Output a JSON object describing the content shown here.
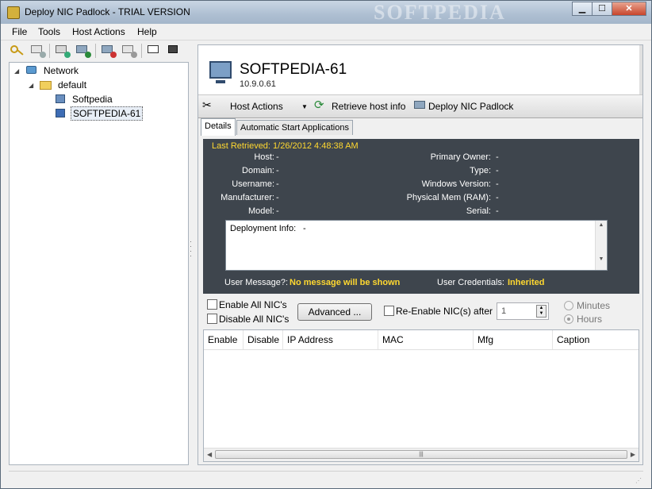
{
  "window": {
    "title": "Deploy NIC Padlock - TRIAL VERSION",
    "watermark": "SOFTPEDIA",
    "controls": {
      "minimize": "▁",
      "maximize": "☐",
      "close": "✕"
    }
  },
  "menu": [
    "File",
    "Tools",
    "Host Actions",
    "Help"
  ],
  "toolbar": {
    "icons": [
      "key-icon",
      "add-host-icon",
      "add-folder-icon",
      "add-network-icon",
      "remove-icon",
      "edit-icon",
      "console-icon",
      "binoculars-icon"
    ]
  },
  "tree": {
    "network": "Network",
    "group": "default",
    "hosts": [
      "Softpedia",
      "SOFTPEDIA-61"
    ],
    "selected": "SOFTPEDIA-61"
  },
  "host": {
    "name": "SOFTPEDIA-61",
    "ip": "10.9.0.61"
  },
  "actionbar": {
    "host_actions": "Host Actions",
    "retrieve": "Retrieve host info",
    "deploy": "Deploy NIC Padlock"
  },
  "tabs": [
    "Details",
    "Automatic Start Applications"
  ],
  "details": {
    "last_retrieved_label": "Last Retrieved:",
    "last_retrieved_value": "1/26/2012 4:48:38 AM",
    "left": [
      {
        "label": "Host:",
        "value": "-"
      },
      {
        "label": "Domain:",
        "value": "-"
      },
      {
        "label": "Username:",
        "value": "-"
      },
      {
        "label": "Manufacturer:",
        "value": "-"
      },
      {
        "label": "Model:",
        "value": "-"
      }
    ],
    "right": [
      {
        "label": "Primary Owner:",
        "value": "-"
      },
      {
        "label": "Type:",
        "value": "-"
      },
      {
        "label": "Windows Version:",
        "value": "-"
      },
      {
        "label": "Physical Mem (RAM):",
        "value": "-"
      },
      {
        "label": "Serial:",
        "value": "-"
      }
    ],
    "deployment_label": "Deployment Info:",
    "deployment_value": "-",
    "user_message_label": "User Message?:",
    "user_message_value": "No message will be shown",
    "user_credentials_label": "User Credentials:",
    "user_credentials_value": "Inherited"
  },
  "nic_controls": {
    "enable_all": "Enable All NIC's",
    "disable_all": "Disable All NIC's",
    "advanced": "Advanced ...",
    "reenable": "Re-Enable NIC(s) after",
    "reenable_value": "1",
    "minutes": "Minutes",
    "hours": "Hours",
    "selected_unit": "Hours"
  },
  "grid": {
    "columns": [
      "Enable",
      "Disable",
      "IP Address",
      "MAC",
      "Mfg",
      "Caption"
    ]
  },
  "colors": {
    "details_bg": "#3e454d",
    "highlight": "#ffd830"
  }
}
